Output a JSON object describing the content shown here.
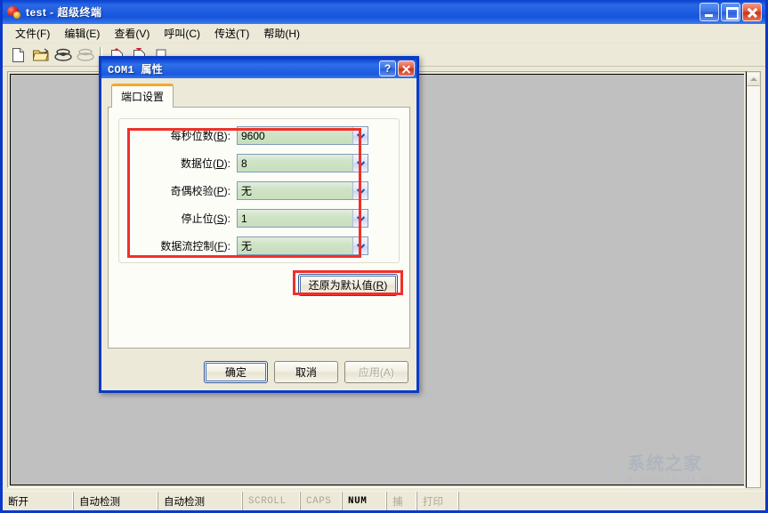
{
  "window": {
    "title": "test - 超级终端",
    "icon": "hyperterminal-icon",
    "controls": {
      "minimize": "minimize-button",
      "maximize": "maximize-button",
      "close": "close-button"
    }
  },
  "menubar": {
    "items": [
      {
        "label": "文件(F)",
        "name": "menu-file"
      },
      {
        "label": "编辑(E)",
        "name": "menu-edit"
      },
      {
        "label": "查看(V)",
        "name": "menu-view"
      },
      {
        "label": "呼叫(C)",
        "name": "menu-call"
      },
      {
        "label": "传送(T)",
        "name": "menu-transfer"
      },
      {
        "label": "帮助(H)",
        "name": "menu-help"
      }
    ]
  },
  "toolbar": {
    "buttons": [
      {
        "name": "new-connection-icon",
        "title": "新建连接"
      },
      {
        "name": "open-folder-icon",
        "title": "打开"
      },
      {
        "name": "call-phone-icon",
        "title": "呼叫"
      },
      {
        "name": "hangup-phone-icon",
        "title": "挂断",
        "disabled": true
      },
      {
        "name": "send-file-icon",
        "title": "发送文件"
      },
      {
        "name": "receive-file-icon",
        "title": "接收文件"
      },
      {
        "name": "properties-icon",
        "title": "属性"
      }
    ]
  },
  "statusbar": {
    "connection": "断开",
    "detect1": "自动检测",
    "detect2": "自动检测",
    "scroll": "SCROLL",
    "caps": "CAPS",
    "num": "NUM",
    "capture": "捕",
    "print": "打印"
  },
  "watermark": {
    "cn": "系统之家",
    "en": "XITONGZHIJIA.NET"
  },
  "dialog": {
    "title": "COM1 属性",
    "help_button": "?",
    "close_button": "close-icon",
    "tabs": [
      {
        "label": "端口设置",
        "name": "tab-port-settings",
        "active": true
      }
    ],
    "fields": [
      {
        "label_prefix": "每秒位数(",
        "accel": "B",
        "label_suffix": "):",
        "value": "9600",
        "name": "bits-per-second"
      },
      {
        "label_prefix": "数据位(",
        "accel": "D",
        "label_suffix": "):",
        "value": "8",
        "name": "data-bits"
      },
      {
        "label_prefix": "奇偶校验(",
        "accel": "P",
        "label_suffix": "):",
        "value": "无",
        "name": "parity"
      },
      {
        "label_prefix": "停止位(",
        "accel": "S",
        "label_suffix": "):",
        "value": "1",
        "name": "stop-bits"
      },
      {
        "label_prefix": "数据流控制(",
        "accel": "F",
        "label_suffix": "):",
        "value": "无",
        "name": "flow-control"
      }
    ],
    "restore_button": {
      "prefix": "还原为默认值(",
      "accel": "R",
      "suffix": ")"
    },
    "footer_buttons": [
      {
        "label": "确定",
        "name": "ok-button",
        "state": "focused"
      },
      {
        "label": "取消",
        "name": "cancel-button",
        "state": "normal"
      },
      {
        "label": "应用(A)",
        "name": "apply-button",
        "state": "disabled"
      }
    ]
  },
  "colors": {
    "accent_blue": "#0a3bc4",
    "titlebar_blue": "#2163e2",
    "highlight_red": "#f0302a",
    "combo_green": "#cfe3c6",
    "face": "#ece9d8",
    "terminal_bg": "#c0c0c0",
    "tab_orange": "#f0a830"
  }
}
